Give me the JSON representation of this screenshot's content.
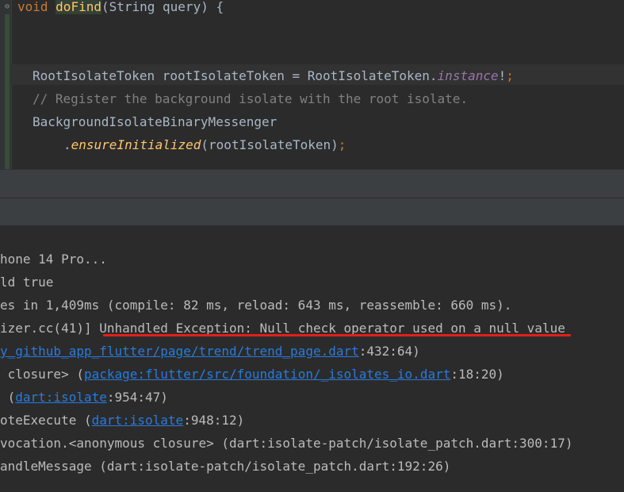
{
  "editor": {
    "line1": {
      "kw": "void",
      "fn": "doFind",
      "rest": "(String query) {"
    },
    "line2": {
      "type1": "RootIsolateToken",
      "var": " rootIsolateToken = ",
      "type2": "RootIsolateToken.",
      "field": "instance",
      "bang": "!",
      "semi": ";"
    },
    "line3": {
      "comment": "// Register the background isolate with the root isolate."
    },
    "line4": {
      "cls": "BackgroundIsolateBinaryMessenger"
    },
    "line5": {
      "dot": ".",
      "method": "ensureInitialized",
      "args": "(rootIsolateToken)",
      "semi": ";"
    }
  },
  "console": {
    "l1": "hone 14 Pro...",
    "l2": "ld true",
    "l3": "es in 1,409ms (compile: 82 ms, reload: 643 ms, reassemble: 660 ms).",
    "l4a": "izer.cc(41)] ",
    "l4b": "Unhandled Exception: Null check operator used on a null value",
    "l5link": "y_github_app_flutter/page/trend/trend_page.dart",
    "l5rest": ":432:64)",
    "l6a": " closure> (",
    "l6link": "package:flutter/src/foundation/_isolates_io.dart",
    "l6rest": ":18:20)",
    "l7a": " (",
    "l7link": "dart:isolate",
    "l7rest": ":954:47)",
    "l8a": "oteExecute (",
    "l8link": "dart:isolate",
    "l8rest": ":948:12)",
    "l9": "vocation.<anonymous closure> (dart:isolate-patch/isolate_patch.dart:300:17)",
    "l10": "andleMessage (dart:isolate-patch/isolate_patch.dart:192:26)"
  },
  "colors": {
    "error_underline": "#e0201b",
    "link": "#287bde"
  }
}
